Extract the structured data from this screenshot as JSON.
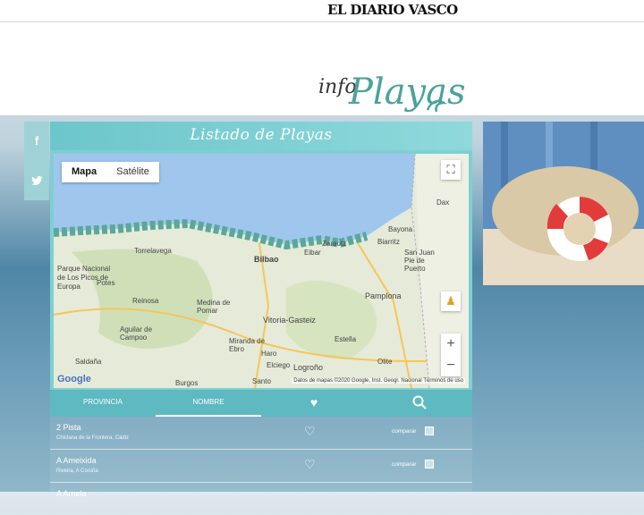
{
  "header": {
    "brand": "EL DIARIO VASCO"
  },
  "logo": {
    "prefix": "info",
    "main": "Playas"
  },
  "share": {
    "facebook": "f",
    "twitter": "t",
    "facebook_icon": "facebook-icon",
    "twitter_icon": "twitter-icon"
  },
  "panel": {
    "title": "Listado de Playas"
  },
  "map": {
    "type_buttons": [
      "Mapa",
      "Satélite"
    ],
    "selected_type": "Mapa",
    "zoom_in": "+",
    "zoom_out": "−",
    "google": "Google",
    "attribution": "Datos de mapas ©2020 Google, Inst. Geogr. Nacional   Términos de uso",
    "places": [
      "Torrelavega",
      "Bilbao",
      "Parque Nacional de Los Picos de Europa",
      "Potes",
      "Reinosa",
      "Medina de Pomar",
      "Aguilar de Campoo",
      "Vitoria-Gasteiz",
      "Pamplona",
      "Miranda de Ebro",
      "Estella",
      "Haro",
      "Logroño",
      "Saldaña",
      "Burgos",
      "Bayona",
      "Biarritz",
      "Dax",
      "Zarautz",
      "Eibar",
      "Olite",
      "Elciego",
      "San Juan Pie de Puerto",
      "Santo"
    ]
  },
  "tabs": [
    {
      "label": "PROVINCIA",
      "icon": null
    },
    {
      "label": "NOMBRE",
      "icon": null
    },
    {
      "label": "",
      "icon": "heart-icon"
    },
    {
      "label": "",
      "icon": "search-icon"
    }
  ],
  "active_tab": "NOMBRE",
  "beaches": [
    {
      "name": "2 Pista",
      "location": "Chiclana de la Frontera, Cádiz",
      "compare": "comparar"
    },
    {
      "name": "A Ameixida",
      "location": "Riveira, A Coruña",
      "compare": "comparar"
    },
    {
      "name": "A Arnela",
      "location": "",
      "compare": ""
    }
  ],
  "colors": {
    "accent": "#5eb9c1",
    "header": "#8fd9dc",
    "logo": "#4aa39a"
  }
}
